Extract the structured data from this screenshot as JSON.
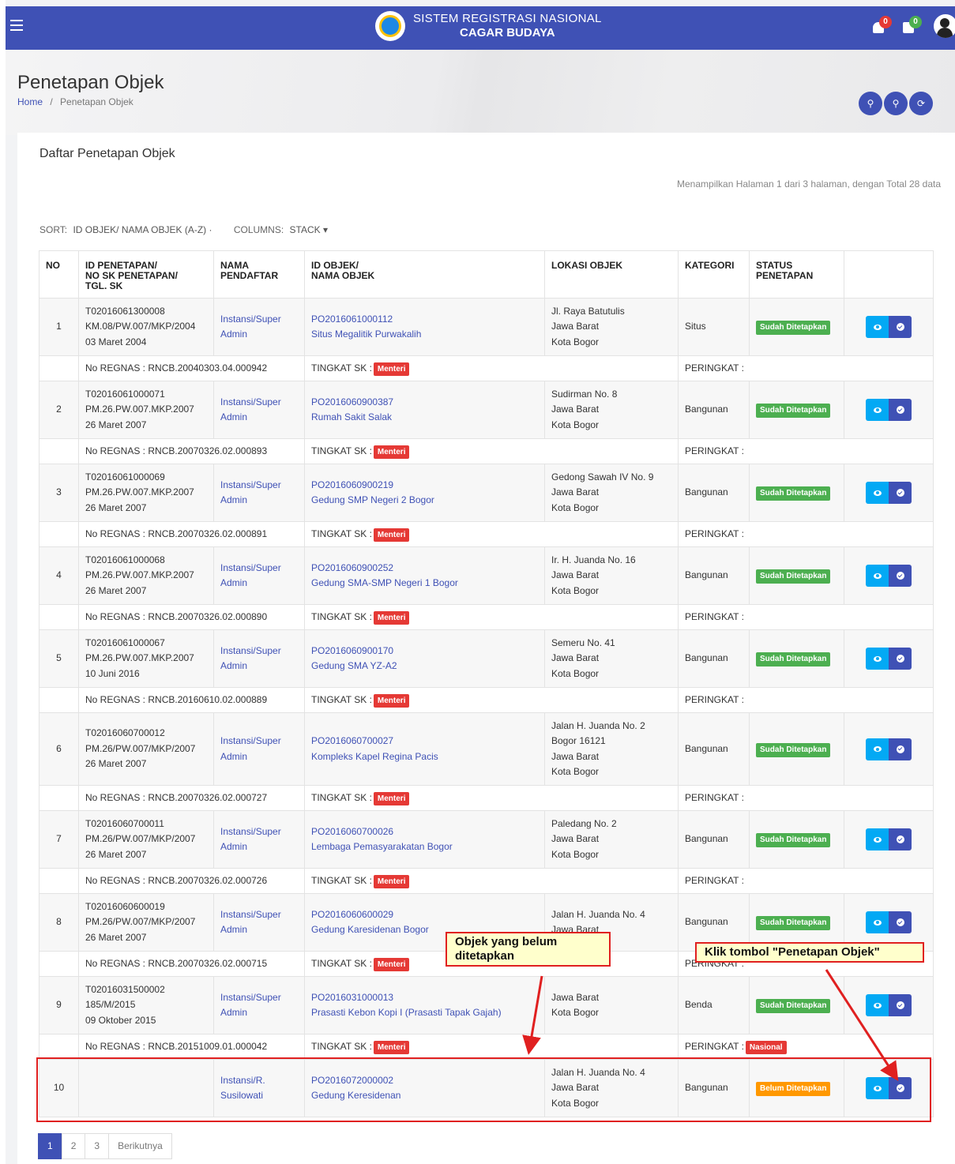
{
  "header": {
    "title_line1": "SISTEM REGISTRASI NASIONAL",
    "title_line2": "CAGAR BUDAYA",
    "notif_count_1": "0",
    "notif_count_2": "0"
  },
  "page": {
    "title": "Penetapan Objek",
    "breadcrumb_home": "Home",
    "breadcrumb_sep": "/",
    "breadcrumb_current": "Penetapan Objek"
  },
  "card": {
    "title": "Daftar Penetapan Objek",
    "info": "Menampilkan Halaman 1 dari 3 halaman, dengan Total 28 data"
  },
  "controls": {
    "sort_label": "SORT:",
    "sort_value": "ID OBJEK/ NAMA OBJEK (A-Z) ·",
    "columns_label": "COLUMNS:",
    "columns_value": "STACK ▾"
  },
  "table": {
    "headers": [
      "NO",
      "ID PENETAPAN/\nNO SK PENETAPAN/\nTGL. SK",
      "NAMA\nPENDAFTAR",
      "ID OBJEK/\nNAMA OBJEK",
      "LOKASI OBJEK",
      "KATEGORI",
      "STATUS\nPENETAPAN",
      ""
    ],
    "sub_regnas_prefix": "No REGNAS : ",
    "sub_tingkat_label": "TINGKAT SK :",
    "sub_peringkat_label": "PERINGKAT :",
    "rows": [
      {
        "no": "1",
        "id_penetapan": "T02016061300008",
        "no_sk": "KM.08/PW.007/MKP/2004",
        "tgl_sk": "03 Maret 2004",
        "pendaftar1": "Instansi/Super",
        "pendaftar2": "Admin",
        "id_objek": "PO2016061000112",
        "nama_objek": "Situs Megalitik Purwakalih",
        "lokasi": [
          "Jl. Raya Batutulis",
          "Jawa Barat",
          "Kota Bogor"
        ],
        "kategori": "Situs",
        "status": "Sudah Ditetapkan",
        "regnas": "RNCB.20040303.04.000942",
        "tingkat": "Menteri",
        "peringkat": ""
      },
      {
        "no": "2",
        "id_penetapan": "T02016061000071",
        "no_sk": "PM.26.PW.007.MKP.2007",
        "tgl_sk": "26 Maret 2007",
        "pendaftar1": "Instansi/Super",
        "pendaftar2": "Admin",
        "id_objek": "PO2016060900387",
        "nama_objek": "Rumah Sakit Salak",
        "lokasi": [
          "Sudirman No. 8",
          "Jawa Barat",
          "Kota Bogor"
        ],
        "kategori": "Bangunan",
        "status": "Sudah Ditetapkan",
        "regnas": "RNCB.20070326.02.000893",
        "tingkat": "Menteri",
        "peringkat": ""
      },
      {
        "no": "3",
        "id_penetapan": "T02016061000069",
        "no_sk": "PM.26.PW.007.MKP.2007",
        "tgl_sk": "26 Maret 2007",
        "pendaftar1": "Instansi/Super",
        "pendaftar2": "Admin",
        "id_objek": "PO2016060900219",
        "nama_objek": "Gedung SMP Negeri 2 Bogor",
        "lokasi": [
          "Gedong Sawah IV No. 9",
          "Jawa Barat",
          "Kota Bogor"
        ],
        "kategori": "Bangunan",
        "status": "Sudah Ditetapkan",
        "regnas": "RNCB.20070326.02.000891",
        "tingkat": "Menteri",
        "peringkat": ""
      },
      {
        "no": "4",
        "id_penetapan": "T02016061000068",
        "no_sk": "PM.26.PW.007.MKP.2007",
        "tgl_sk": "26 Maret 2007",
        "pendaftar1": "Instansi/Super",
        "pendaftar2": "Admin",
        "id_objek": "PO2016060900252",
        "nama_objek": "Gedung SMA-SMP Negeri 1 Bogor",
        "lokasi": [
          "Ir. H. Juanda No. 16",
          "Jawa Barat",
          "Kota Bogor"
        ],
        "kategori": "Bangunan",
        "status": "Sudah Ditetapkan",
        "regnas": "RNCB.20070326.02.000890",
        "tingkat": "Menteri",
        "peringkat": ""
      },
      {
        "no": "5",
        "id_penetapan": "T02016061000067",
        "no_sk": "PM.26.PW.007.MKP.2007",
        "tgl_sk": "10 Juni 2016",
        "pendaftar1": "Instansi/Super",
        "pendaftar2": "Admin",
        "id_objek": "PO2016060900170",
        "nama_objek": "Gedung SMA YZ-A2",
        "lokasi": [
          "Semeru No. 41",
          "Jawa Barat",
          "Kota Bogor"
        ],
        "kategori": "Bangunan",
        "status": "Sudah Ditetapkan",
        "regnas": "RNCB.20160610.02.000889",
        "tingkat": "Menteri",
        "peringkat": ""
      },
      {
        "no": "6",
        "id_penetapan": "T02016060700012",
        "no_sk": "PM.26/PW.007/MKP/2007",
        "tgl_sk": "26 Maret 2007",
        "pendaftar1": "Instansi/Super",
        "pendaftar2": "Admin",
        "id_objek": "PO2016060700027",
        "nama_objek": "Kompleks Kapel Regina Pacis",
        "lokasi": [
          "Jalan H. Juanda No. 2",
          "Bogor 16121",
          "Jawa Barat",
          "Kota Bogor"
        ],
        "kategori": "Bangunan",
        "status": "Sudah Ditetapkan",
        "regnas": "RNCB.20070326.02.000727",
        "tingkat": "Menteri",
        "peringkat": ""
      },
      {
        "no": "7",
        "id_penetapan": "T02016060700011",
        "no_sk": "PM.26/PW.007/MKP/2007",
        "tgl_sk": "26 Maret 2007",
        "pendaftar1": "Instansi/Super",
        "pendaftar2": "Admin",
        "id_objek": "PO2016060700026",
        "nama_objek": "Lembaga Pemasyarakatan Bogor",
        "lokasi": [
          "Paledang No. 2",
          "Jawa Barat",
          "Kota Bogor"
        ],
        "kategori": "Bangunan",
        "status": "Sudah Ditetapkan",
        "regnas": "RNCB.20070326.02.000726",
        "tingkat": "Menteri",
        "peringkat": ""
      },
      {
        "no": "8",
        "id_penetapan": "T02016060600019",
        "no_sk": "PM.26/PW.007/MKP/2007",
        "tgl_sk": "26 Maret 2007",
        "pendaftar1": "Instansi/Super",
        "pendaftar2": "Admin",
        "id_objek": "PO2016060600029",
        "nama_objek": "Gedung Karesidenan Bogor",
        "lokasi": [
          "Jalan H. Juanda No. 4",
          "Jawa Barat"
        ],
        "kategori": "Bangunan",
        "status": "Sudah Ditetapkan",
        "regnas": "RNCB.20070326.02.000715",
        "tingkat": "Menteri",
        "peringkat": ""
      },
      {
        "no": "9",
        "id_penetapan": "T02016031500002",
        "no_sk": "185/M/2015",
        "tgl_sk": "09 Oktober 2015",
        "pendaftar1": "Instansi/Super",
        "pendaftar2": "Admin",
        "id_objek": "PO2016031000013",
        "nama_objek": "Prasasti Kebon Kopi I (Prasasti Tapak Gajah)",
        "lokasi": [
          "Jawa Barat",
          "Kota Bogor"
        ],
        "kategori": "Benda",
        "status": "Sudah Ditetapkan",
        "regnas": "RNCB.20151009.01.000042",
        "tingkat": "Menteri",
        "peringkat": "Nasional"
      },
      {
        "no": "10",
        "id_penetapan": "",
        "no_sk": "",
        "tgl_sk": "",
        "pendaftar1": "Instansi/R.",
        "pendaftar2": "Susilowati",
        "id_objek": "PO2016072000002",
        "nama_objek": "Gedung Keresidenan",
        "lokasi": [
          "Jalan H. Juanda No. 4",
          "Jawa Barat",
          "Kota Bogor"
        ],
        "kategori": "Bangunan",
        "status": "Belum Ditetapkan"
      }
    ]
  },
  "annotations": {
    "callout_left": "Objek yang belum ditetapkan",
    "callout_right": "Klik tombol \"Penetapan Objek\""
  },
  "pagination": [
    "1",
    "2",
    "3",
    "Berikutnya"
  ],
  "colors": {
    "primary": "#3f51b5",
    "success": "#4caf50",
    "warning": "#ff9800",
    "danger": "#e53935",
    "info": "#03a9f4",
    "annotation": "#e02020"
  }
}
